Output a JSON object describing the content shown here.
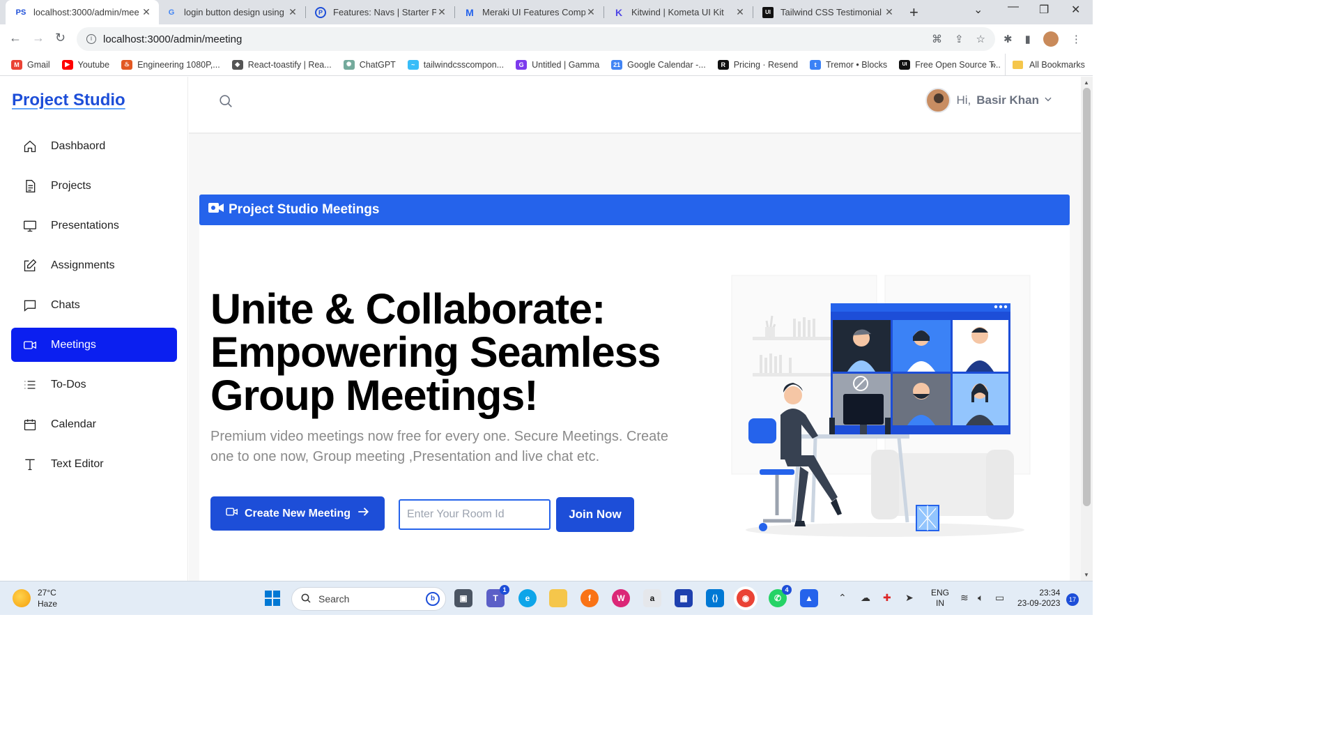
{
  "browser": {
    "tabs": [
      {
        "label": "localhost:3000/admin/mee",
        "favicon": "PS",
        "active": true
      },
      {
        "label": "login button design using",
        "favicon": "G"
      },
      {
        "label": "Features: Navs | Starter Pag",
        "favicon": "P"
      },
      {
        "label": "Meraki UI Features Compo",
        "favicon": "M"
      },
      {
        "label": "Kitwind | Kometa UI Kit",
        "favicon": "K"
      },
      {
        "label": "Tailwind CSS Testimonial C",
        "favicon": "UI"
      }
    ],
    "url": "localhost:3000/admin/meeting",
    "bookmarks": [
      {
        "label": "Gmail",
        "color": "#ea4335",
        "glyph": "M"
      },
      {
        "label": "Youtube",
        "color": "#ff0000",
        "glyph": "▶"
      },
      {
        "label": "Engineering 1080P,...",
        "color": "#e25822",
        "glyph": "♨"
      },
      {
        "label": "React-toastify | Rea...",
        "color": "#555555",
        "glyph": "◆"
      },
      {
        "label": "ChatGPT",
        "color": "#74aa9c",
        "glyph": "✺"
      },
      {
        "label": "tailwindcsscompon...",
        "color": "#38bdf8",
        "glyph": "~"
      },
      {
        "label": "Untitled | Gamma",
        "color": "#7c3aed",
        "glyph": "G"
      },
      {
        "label": "Google Calendar -...",
        "color": "#4285f4",
        "glyph": "21"
      },
      {
        "label": "Pricing · Resend",
        "color": "#111111",
        "glyph": "R"
      },
      {
        "label": "Tremor • Blocks",
        "color": "#3b82f6",
        "glyph": "t"
      },
      {
        "label": "Free Open Source T...",
        "color": "#111111",
        "glyph": "UI"
      }
    ],
    "all_bookmarks": "All Bookmarks",
    "more": "»"
  },
  "sidebar": {
    "logo": "Project Studio",
    "items": [
      {
        "label": "Dashbaord",
        "icon": "home-icon"
      },
      {
        "label": "Projects",
        "icon": "document-icon"
      },
      {
        "label": "Presentations",
        "icon": "monitor-icon"
      },
      {
        "label": "Assignments",
        "icon": "edit-icon"
      },
      {
        "label": "Chats",
        "icon": "chat-icon"
      },
      {
        "label": "Meetings",
        "icon": "video-icon",
        "active": true
      },
      {
        "label": "To-Dos",
        "icon": "list-icon"
      },
      {
        "label": "Calendar",
        "icon": "calendar-icon"
      },
      {
        "label": "Text Editor",
        "icon": "text-icon"
      }
    ]
  },
  "header": {
    "greeting": "Hi,",
    "user_name": "Basir Khan"
  },
  "main": {
    "banner_title": "Project Studio Meetings",
    "headline": "Unite & Collaborate: Empowering Seamless Group Meetings!",
    "subtext": "Premium video meetings now free for every one. Secure Meetings. Create one to one now, Group meeting ,Presentation and live chat etc.",
    "create_button": "Create New Meeting",
    "room_placeholder": "Enter Your Room Id",
    "join_button": "Join Now"
  },
  "taskbar": {
    "temperature": "27°C",
    "weather": "Haze",
    "search": "Search",
    "lang_line1": "ENG",
    "lang_line2": "IN",
    "time": "23:34",
    "date": "23-09-2023",
    "notifications": "17",
    "teams_badge": "1",
    "whatsapp_badge": "4"
  },
  "colors": {
    "accent": "#1d4ed8",
    "active_nav": "#0b1ff0",
    "banner": "#2563eb"
  }
}
